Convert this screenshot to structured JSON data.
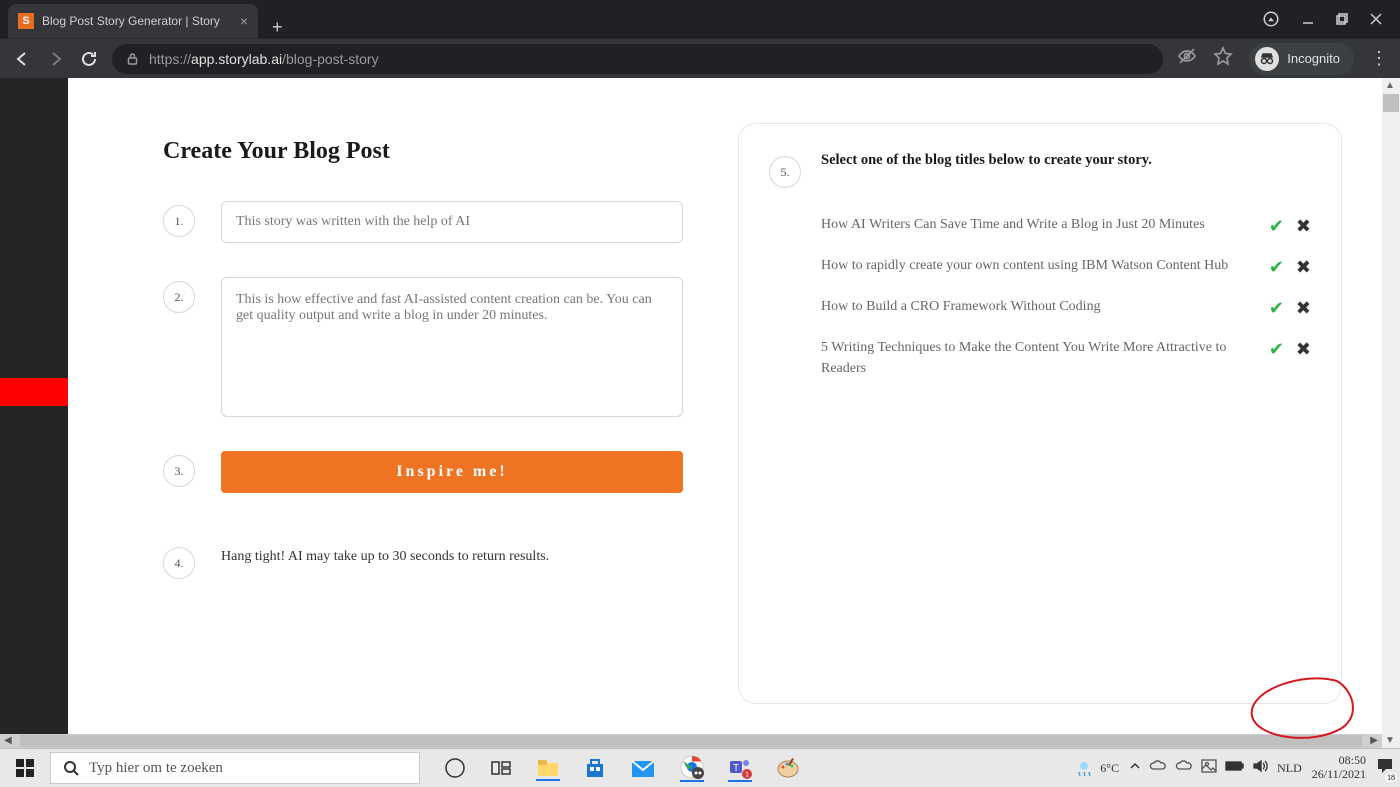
{
  "browser": {
    "tab_title": "Blog Post Story Generator | Story",
    "favicon_letter": "S",
    "url_host": "app.storylab.ai",
    "url_prefix": "https://",
    "url_path": "/blog-post-story",
    "incognito_label": "Incognito"
  },
  "page": {
    "heading": "Create Your Blog Post",
    "step1_num": "1.",
    "step1_value": "This story was written with the help of AI",
    "step2_num": "2.",
    "step2_value": "This is how effective and fast AI-assisted content creation can be. You can get quality output and write a blog in under 20 minutes.",
    "step3_num": "3.",
    "inspire_label": "Inspire me!",
    "step4_num": "4.",
    "step4_text": "Hang tight! AI may take up to 30 seconds to return results.",
    "step5_num": "5.",
    "step5_text": "Select one of the blog titles below to create your story.",
    "titles": [
      " How AI Writers Can Save Time and Write a Blog in Just 20 Minutes",
      " How to rapidly create your own content using IBM Watson Content Hub",
      " How to Build a CRO Framework Without Coding",
      " 5 Writing Techniques to Make the Content You Write More Attractive to Readers"
    ]
  },
  "taskbar": {
    "search_placeholder": "Typ hier om te zoeken",
    "weather_temp": "6°C",
    "lang": "NLD",
    "time": "08:50",
    "date": "26/11/2021",
    "notif_count": "18"
  }
}
